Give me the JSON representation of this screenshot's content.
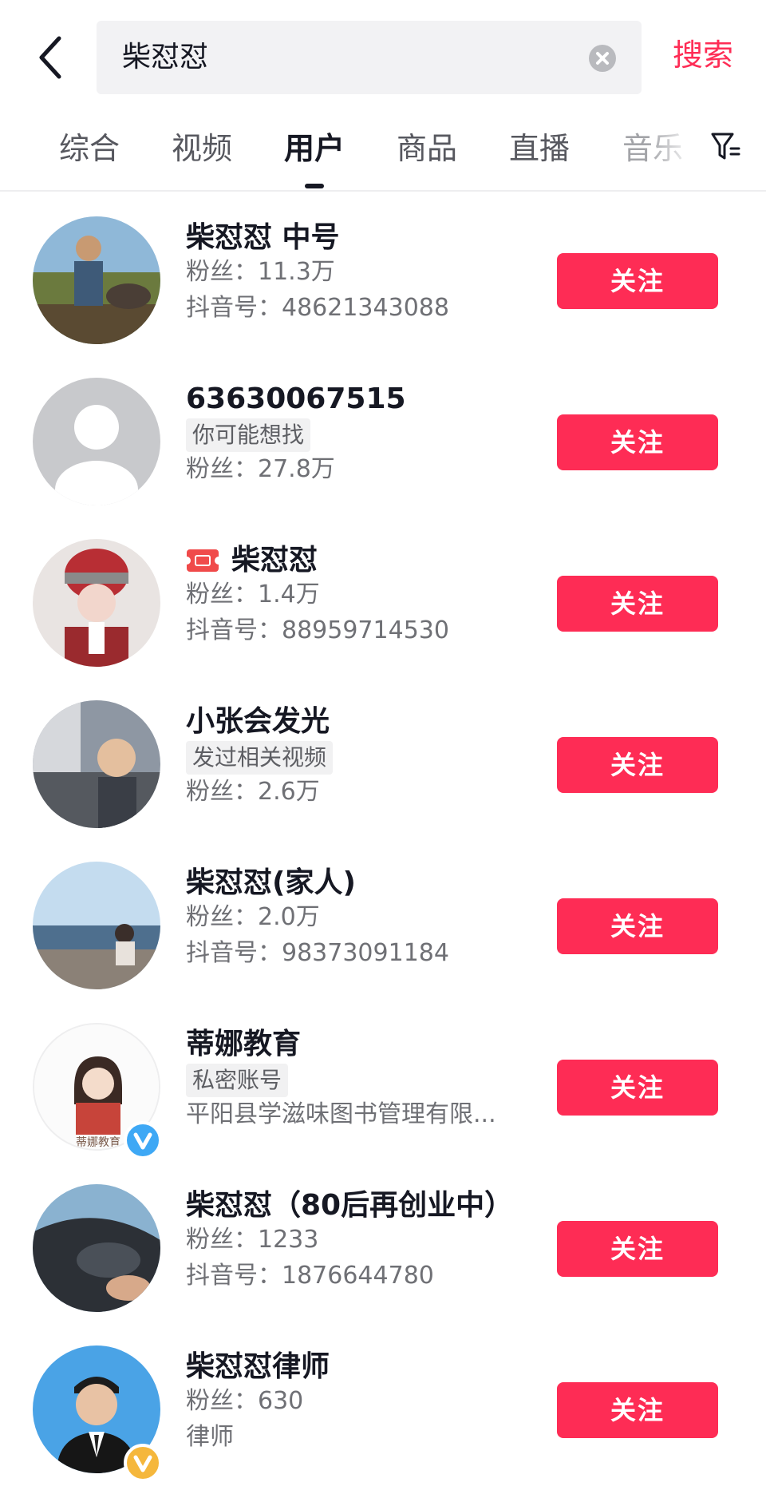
{
  "search": {
    "query": "柴怼怼",
    "submit_label": "搜索"
  },
  "tabs": [
    {
      "label": "综合",
      "active": false
    },
    {
      "label": "视频",
      "active": false
    },
    {
      "label": "用户",
      "active": true
    },
    {
      "label": "商品",
      "active": false
    },
    {
      "label": "直播",
      "active": false
    },
    {
      "label": "音乐",
      "active": false
    }
  ],
  "icons": {
    "back": "back-arrow-icon",
    "clear": "clear-icon",
    "filter": "filter-icon",
    "ticket": "ticket-icon",
    "verified": "verified-badge-icon"
  },
  "colors": {
    "accent": "#fe2c55",
    "text_primary": "#161823",
    "text_secondary": "#6f7075",
    "verified_badge": "#f5b73c",
    "verified_badge_blue": "#3ea8f5"
  },
  "users": [
    {
      "name": "柴怼怼 中号",
      "line1": "粉丝：11.3万",
      "line2": "抖音号：48621343088",
      "follow_label": "关注"
    },
    {
      "name": "63630067515",
      "tag": "你可能想找",
      "line2": "粉丝：27.8万",
      "follow_label": "关注"
    },
    {
      "name": "柴怼怼",
      "line1": "粉丝：1.4万",
      "line2": "抖音号：88959714530",
      "follow_label": "关注"
    },
    {
      "name": "小张会发光",
      "tag": "发过相关视频",
      "line2": "粉丝：2.6万",
      "follow_label": "关注"
    },
    {
      "name": "柴怼怼(家人)",
      "line1": "粉丝：2.0万",
      "line2": "抖音号：98373091184",
      "follow_label": "关注"
    },
    {
      "name": "蒂娜教育",
      "tag": "私密账号",
      "line2": "平阳县学滋味图书管理有限...",
      "follow_label": "关注",
      "avatar_text": "蒂娜教育"
    },
    {
      "name": "柴怼怼（80后再创业中）",
      "line1": "粉丝：1233",
      "line2": "抖音号：1876644780",
      "follow_label": "关注"
    },
    {
      "name": "柴怼怼律师",
      "line1": "粉丝：630",
      "line2": "律师",
      "follow_label": "关注"
    }
  ]
}
